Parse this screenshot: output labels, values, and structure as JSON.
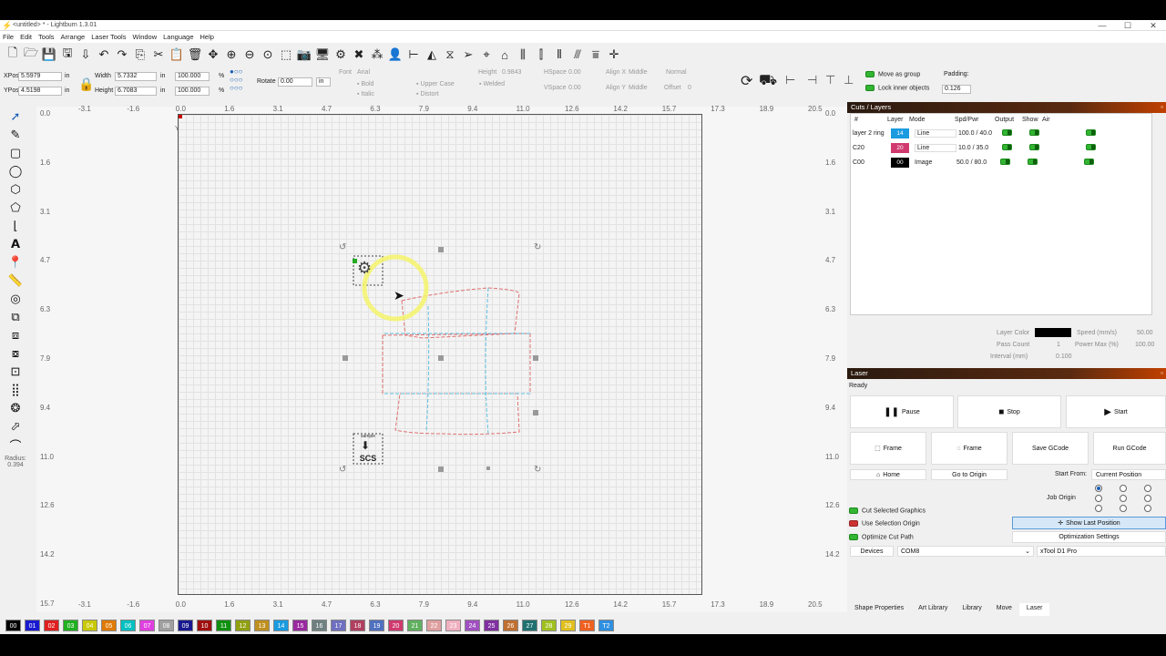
{
  "window": {
    "title": "<untitled> * - Lightburn 1.3.01",
    "min": "—",
    "max": "☐",
    "close": "✕"
  },
  "menu": [
    "File",
    "Edit",
    "Tools",
    "Arrange",
    "Laser Tools",
    "Window",
    "Language",
    "Help"
  ],
  "toolbar_icons": [
    "new-icon",
    "open-icon",
    "save-icon",
    "save-as-icon",
    "import-icon",
    "undo-icon",
    "redo-icon",
    "copy-icon",
    "cut-icon",
    "paste-icon",
    "delete-icon",
    "move-icon",
    "zoom-in-icon",
    "zoom-out-icon",
    "zoom-fit-icon",
    "camera-icon",
    "monitor-icon",
    "settings-icon",
    "tools-icon",
    "group-icon",
    "user-icon",
    "align-icon",
    "align2-icon",
    "flip-icon",
    "mirror-icon",
    "send-icon",
    "target-icon",
    "frame-icon",
    "distribute-icon",
    "distribute2-icon",
    "distribute3-icon",
    "distribute4-icon",
    "crosshair-icon"
  ],
  "props": {
    "xpos_label": "XPos",
    "xpos": "5.5979",
    "ypos_label": "YPos",
    "ypos": "4.5198",
    "unit": "in",
    "width_label": "Width",
    "width": "5.7332",
    "height_label": "Height",
    "height": "6.7083",
    "wpct": "100.000",
    "hpct": "100.000",
    "pct": "%",
    "rotate_label": "Rotate",
    "rotate": "0.00",
    "rot_unit": "in",
    "font_label": "Font",
    "font": "Arial",
    "fheight_label": "Height",
    "fheight": "0.9843",
    "hspace_label": "HSpace",
    "hspace": "0.00",
    "vspace_label": "VSpace",
    "vspace": "0.00",
    "alignx_label": "Align X",
    "alignx": "Middle",
    "aligny_label": "Align Y",
    "aligny": "Middle",
    "normal": "Normal",
    "offset_label": "Offset",
    "offset": "0",
    "bold": "Bold",
    "italic": "Italic",
    "upper": "Upper Case",
    "distort": "Distort",
    "welded": "Welded",
    "move_group": "Move as group",
    "lock_inner": "Lock inner objects",
    "padding_label": "Padding:",
    "padding": "0.126"
  },
  "ruler_x_top": [
    "-3.1",
    "-1.6",
    "0.0",
    "1.6",
    "3.1",
    "4.7",
    "6.3",
    "7.9",
    "9.4",
    "11.0",
    "12.6",
    "14.2",
    "15.7",
    "17.3",
    "18.9",
    "20.5"
  ],
  "ruler_x_bottom": [
    "-3.1",
    "-1.6",
    "0.0",
    "1.6",
    "3.1",
    "4.7",
    "6.3",
    "7.9",
    "9.4",
    "11.0",
    "12.6",
    "14.2",
    "15.7",
    "17.3",
    "18.9",
    "20.5"
  ],
  "ruler_y": [
    "0.0",
    "1.6",
    "3.1",
    "4.7",
    "6.3",
    "7.9",
    "9.4",
    "11.0",
    "12.6",
    "14.2",
    "15.7"
  ],
  "ruler_y_right": [
    "0.0",
    "1.6",
    "3.1",
    "4.7",
    "6.3",
    "7.9",
    "9.4",
    "11.0",
    "12.6",
    "14.2"
  ],
  "y_axis_label": "Y",
  "radius_label": "Radius:",
  "radius": "0.394",
  "cuts": {
    "title": "Cuts / Layers",
    "headers": [
      "#",
      "Layer",
      "Mode",
      "Spd/Pwr",
      "Output",
      "Show",
      "Air"
    ],
    "rows": [
      {
        "name": "layer 2 ring",
        "layer": "14",
        "color": "#1a9be0",
        "mode": "Line",
        "spd": "100.0 / 40.0"
      },
      {
        "name": "C20",
        "layer": "20",
        "color": "#d03a6e",
        "mode": "Line",
        "spd": "10.0 / 35.0"
      },
      {
        "name": "C00",
        "layer": "00",
        "color": "#000000",
        "mode": "Image",
        "spd": "50.0 / 80.0"
      }
    ],
    "layer_color_label": "Layer Color",
    "speed_label": "Speed (mm/s)",
    "speed": "50.00",
    "pass_label": "Pass Count",
    "pass": "1",
    "power_label": "Power Max (%)",
    "power": "100.00",
    "interval_label": "Interval (mm)",
    "interval": "0.100"
  },
  "laser": {
    "title": "Laser",
    "status": "Ready",
    "pause": "Pause",
    "stop": "Stop",
    "start": "Start",
    "frame1": "Frame",
    "frame2": "Frame",
    "save_gcode": "Save GCode",
    "run_gcode": "Run GCode",
    "home": "Home",
    "go_origin": "Go to Origin",
    "start_from_label": "Start From:",
    "start_from": "Current Position",
    "job_origin": "Job Origin",
    "cut_selected": "Cut Selected Graphics",
    "use_selection": "Use Selection Origin",
    "optimize": "Optimize Cut Path",
    "show_last": "Show Last Position",
    "opt_settings": "Optimization Settings",
    "devices": "Devices",
    "port": "COM8",
    "device": "xTool D1 Pro"
  },
  "bottom_tabs": [
    "Shape Properties",
    "Art Library",
    "Library",
    "Move",
    "Laser"
  ],
  "palette": [
    {
      "l": "00",
      "c": "#000000"
    },
    {
      "l": "01",
      "c": "#1a1ad0"
    },
    {
      "l": "02",
      "c": "#e02020"
    },
    {
      "l": "03",
      "c": "#20b020"
    },
    {
      "l": "04",
      "c": "#c8c800"
    },
    {
      "l": "05",
      "c": "#e07a00"
    },
    {
      "l": "06",
      "c": "#00c0c0"
    },
    {
      "l": "07",
      "c": "#e040e0"
    },
    {
      "l": "08",
      "c": "#a0a0a0"
    },
    {
      "l": "09",
      "c": "#1a1a90"
    },
    {
      "l": "10",
      "c": "#a01010"
    },
    {
      "l": "11",
      "c": "#109010"
    },
    {
      "l": "12",
      "c": "#90a010"
    },
    {
      "l": "13",
      "c": "#c09020"
    },
    {
      "l": "14",
      "c": "#1a9be0"
    },
    {
      "l": "15",
      "c": "#9a2aa0"
    },
    {
      "l": "16",
      "c": "#708080"
    },
    {
      "l": "17",
      "c": "#7070c0"
    },
    {
      "l": "18",
      "c": "#b04060"
    },
    {
      "l": "19",
      "c": "#5070c0"
    },
    {
      "l": "20",
      "c": "#d03a6e"
    },
    {
      "l": "21",
      "c": "#60b060"
    },
    {
      "l": "22",
      "c": "#e0a0a0"
    },
    {
      "l": "23",
      "c": "#f0b0c0"
    },
    {
      "l": "24",
      "c": "#a050c0"
    },
    {
      "l": "25",
      "c": "#8030a0"
    },
    {
      "l": "26",
      "c": "#c07030"
    },
    {
      "l": "27",
      "c": "#207070"
    },
    {
      "l": "28",
      "c": "#a0c020"
    },
    {
      "l": "29",
      "c": "#e0c020"
    },
    {
      "l": "T1",
      "c": "#f06020"
    },
    {
      "l": "T2",
      "c": "#3090e0"
    }
  ],
  "canvas_logo": {
    "top": "sample",
    "bottom": "SCS"
  }
}
